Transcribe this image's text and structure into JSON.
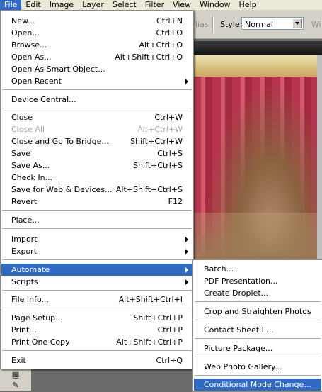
{
  "menubar": {
    "items": [
      "File",
      "Edit",
      "Image",
      "Layer",
      "Select",
      "Filter",
      "View",
      "Window",
      "Help"
    ]
  },
  "options_bar": {
    "antialias_fragment": "lias",
    "style_label": "Style:",
    "style_value": "Normal",
    "width_fragment": "Wi"
  },
  "file_menu": {
    "items": [
      {
        "label": "New...",
        "shortcut": "Ctrl+N"
      },
      {
        "label": "Open...",
        "shortcut": "Ctrl+O"
      },
      {
        "label": "Browse...",
        "shortcut": "Alt+Ctrl+O"
      },
      {
        "label": "Open As...",
        "shortcut": "Alt+Shift+Ctrl+O"
      },
      {
        "label": "Open As Smart Object...",
        "shortcut": ""
      },
      {
        "label": "Open Recent",
        "shortcut": ""
      },
      {
        "label": "Device Central...",
        "shortcut": ""
      },
      {
        "label": "Close",
        "shortcut": "Ctrl+W"
      },
      {
        "label": "Close All",
        "shortcut": "Alt+Ctrl+W"
      },
      {
        "label": "Close and Go To Bridge...",
        "shortcut": "Shift+Ctrl+W"
      },
      {
        "label": "Save",
        "shortcut": "Ctrl+S"
      },
      {
        "label": "Save As...",
        "shortcut": "Shift+Ctrl+S"
      },
      {
        "label": "Check In...",
        "shortcut": ""
      },
      {
        "label": "Save for Web & Devices...",
        "shortcut": "Alt+Shift+Ctrl+S"
      },
      {
        "label": "Revert",
        "shortcut": "F12"
      },
      {
        "label": "Place...",
        "shortcut": ""
      },
      {
        "label": "Import",
        "shortcut": ""
      },
      {
        "label": "Export",
        "shortcut": ""
      },
      {
        "label": "Automate",
        "shortcut": ""
      },
      {
        "label": "Scripts",
        "shortcut": ""
      },
      {
        "label": "File Info...",
        "shortcut": "Alt+Shift+Ctrl+I"
      },
      {
        "label": "Page Setup...",
        "shortcut": "Shift+Ctrl+P"
      },
      {
        "label": "Print...",
        "shortcut": "Ctrl+P"
      },
      {
        "label": "Print One Copy",
        "shortcut": "Alt+Shift+Ctrl+P"
      },
      {
        "label": "Exit",
        "shortcut": "Ctrl+Q"
      }
    ]
  },
  "automate_submenu": {
    "items": [
      {
        "label": "Batch..."
      },
      {
        "label": "PDF Presentation..."
      },
      {
        "label": "Create Droplet..."
      },
      {
        "label": "Crop and Straighten Photos"
      },
      {
        "label": "Contact Sheet II..."
      },
      {
        "label": "Picture Package..."
      },
      {
        "label": "Web Photo Gallery..."
      },
      {
        "label": "Conditional Mode Change..."
      }
    ]
  },
  "colors": {
    "highlight": "#316ac5",
    "menu_bg": "#ffffff",
    "chrome": "#d4d0c8",
    "disabled_text": "#a7a6aa"
  }
}
